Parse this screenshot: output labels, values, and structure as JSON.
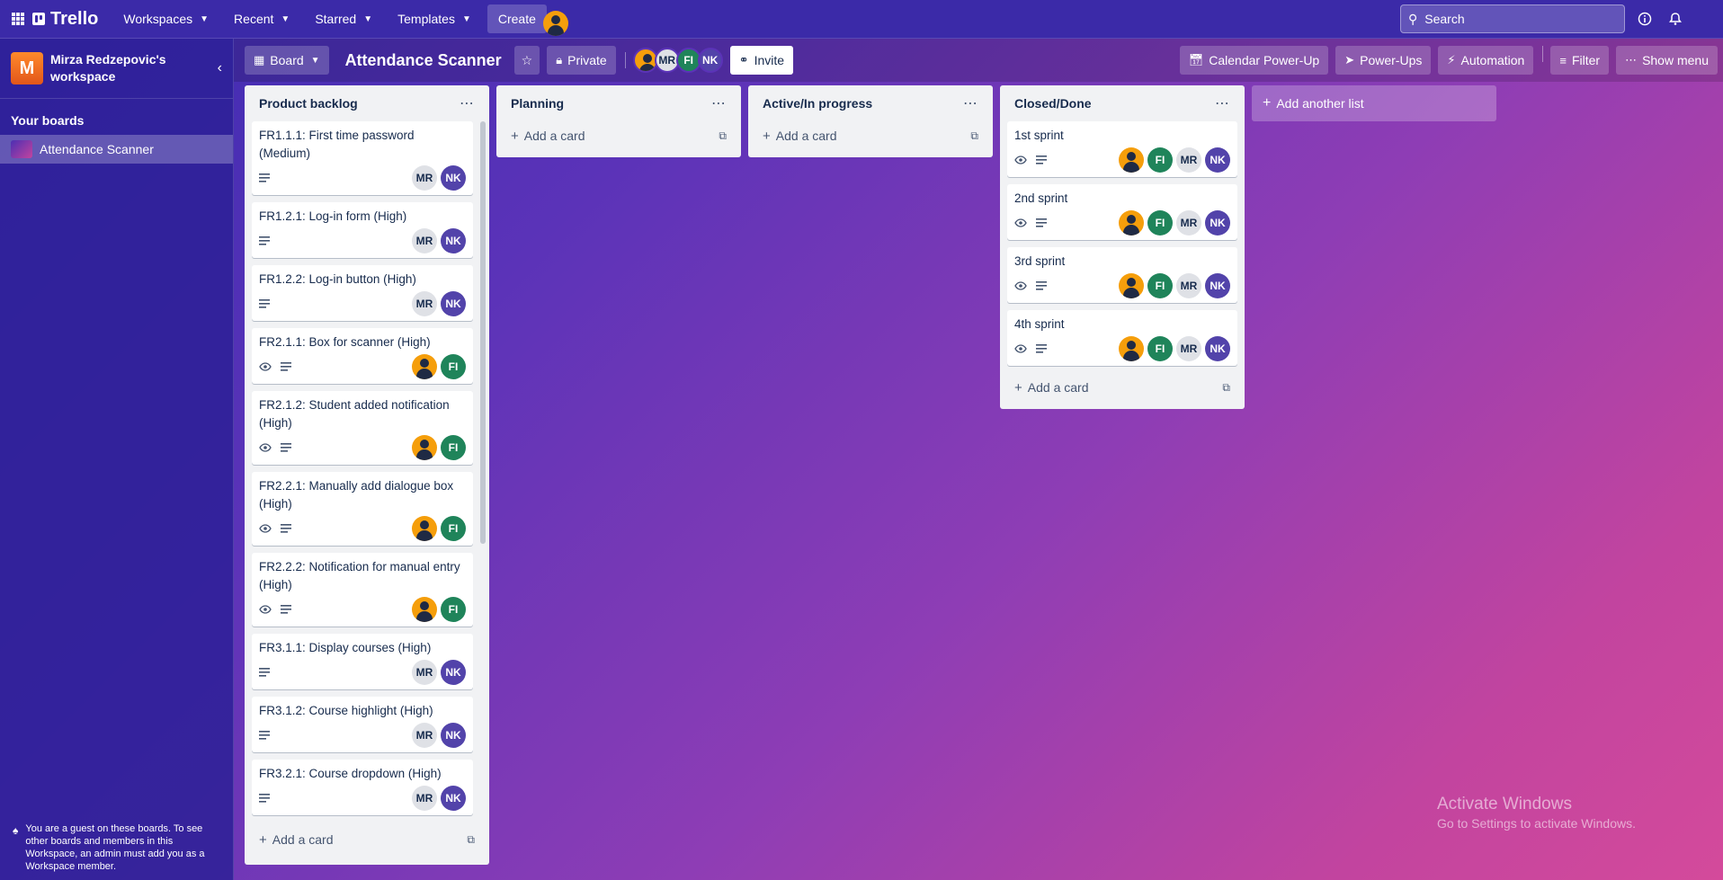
{
  "topbar": {
    "brand": "Trello",
    "nav": [
      {
        "label": "Workspaces"
      },
      {
        "label": "Recent"
      },
      {
        "label": "Starred"
      },
      {
        "label": "Templates"
      }
    ],
    "create_label": "Create",
    "search_placeholder": "Search"
  },
  "sidebar": {
    "workspace_initial": "M",
    "workspace_name": "Mirza Redzepovic's workspace",
    "your_boards_label": "Your boards",
    "boards": [
      {
        "label": "Attendance Scanner"
      }
    ],
    "guest_note": "You are a guest on these boards. To see other boards and members in this Workspace, an admin must add you as a Workspace member."
  },
  "board": {
    "view_label": "Board",
    "title": "Attendance Scanner",
    "visibility_label": "Private",
    "members": [
      "MR",
      "FI",
      "NK"
    ],
    "invite_label": "Invite",
    "right_buttons": [
      "Calendar Power-Up",
      "Power-Ups",
      "Automation",
      "Filter",
      "Show menu"
    ]
  },
  "lists": [
    {
      "title": "Product backlog",
      "add_card_label": "Add a card",
      "cards": [
        {
          "title": "FR1.1.1: First time password (Medium)",
          "watch": false,
          "members": [
            "MR",
            "NK"
          ]
        },
        {
          "title": "FR1.2.1: Log-in form (High)",
          "watch": false,
          "members": [
            "MR",
            "NK"
          ]
        },
        {
          "title": "FR1.2.2: Log-in button (High)",
          "watch": false,
          "members": [
            "MR",
            "NK"
          ]
        },
        {
          "title": "FR2.1.1: Box for scanner (High)",
          "watch": true,
          "members": [
            "photo",
            "FI"
          ]
        },
        {
          "title": "FR2.1.2: Student added notification (High)",
          "watch": true,
          "members": [
            "photo",
            "FI"
          ]
        },
        {
          "title": "FR2.2.1: Manually add dialogue box (High)",
          "watch": true,
          "members": [
            "photo",
            "FI"
          ]
        },
        {
          "title": "FR2.2.2: Notification for manual entry (High)",
          "watch": true,
          "members": [
            "photo",
            "FI"
          ]
        },
        {
          "title": "FR3.1.1: Display courses (High)",
          "watch": false,
          "members": [
            "MR",
            "NK"
          ]
        },
        {
          "title": "FR3.1.2: Course highlight (High)",
          "watch": false,
          "members": [
            "MR",
            "NK"
          ]
        },
        {
          "title": "FR3.2.1: Course dropdown (High)",
          "watch": false,
          "members": [
            "MR",
            "NK"
          ]
        }
      ]
    },
    {
      "title": "Planning",
      "add_card_label": "Add a card",
      "cards": []
    },
    {
      "title": "Active/In progress",
      "add_card_label": "Add a card",
      "cards": []
    },
    {
      "title": "Closed/Done",
      "add_card_label": "Add a card",
      "cards": [
        {
          "title": "1st sprint",
          "watch": true,
          "members": [
            "photo",
            "FI",
            "MR",
            "NK"
          ]
        },
        {
          "title": "2nd sprint",
          "watch": true,
          "members": [
            "photo",
            "FI",
            "MR",
            "NK"
          ]
        },
        {
          "title": "3rd sprint",
          "watch": true,
          "members": [
            "photo",
            "FI",
            "MR",
            "NK"
          ]
        },
        {
          "title": "4th sprint",
          "watch": true,
          "members": [
            "photo",
            "FI",
            "MR",
            "NK"
          ]
        }
      ]
    }
  ],
  "add_list_label": "Add another list",
  "watermark": {
    "line1": "Activate Windows",
    "line2": "Go to Settings to activate Windows."
  }
}
